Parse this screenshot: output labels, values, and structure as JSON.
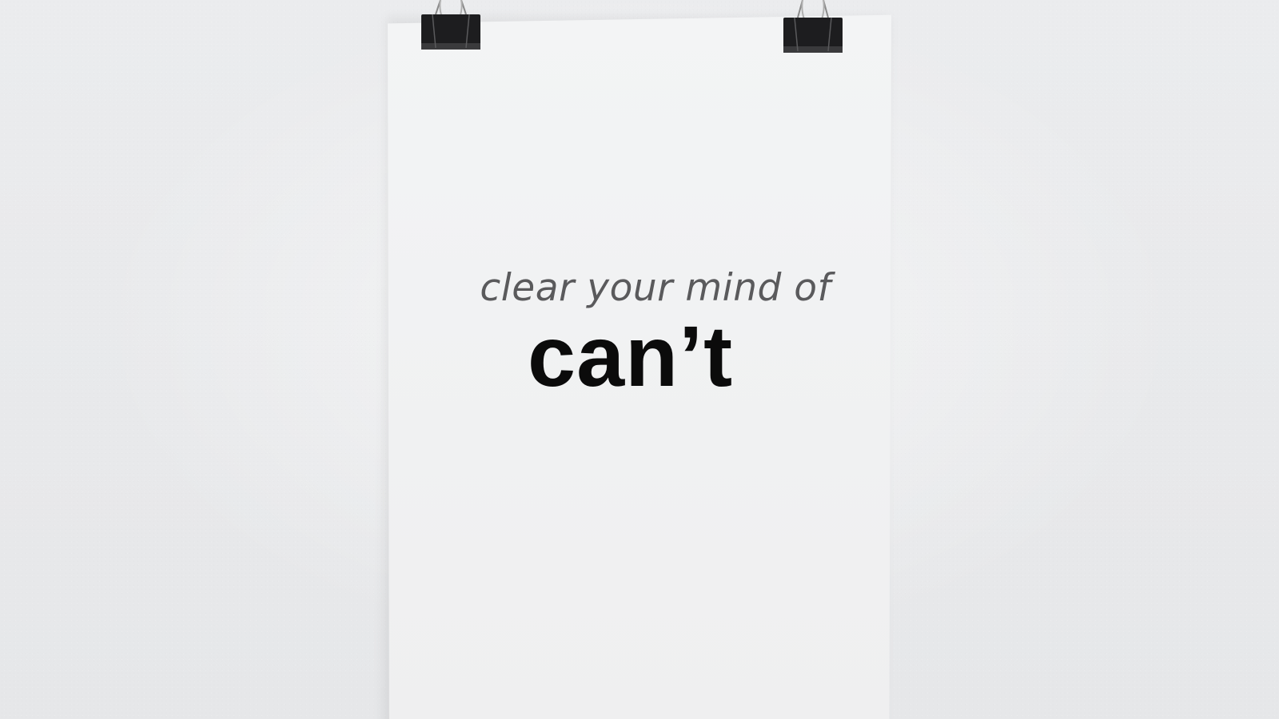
{
  "scene": {
    "background_color": "#e9eaeb",
    "poster_color": "#f2f3f4"
  },
  "poster": {
    "line_1": "clear your mind of",
    "line_2": "can’t",
    "line_1_color": "#5a5a5c",
    "line_2_color": "#0b0b0b"
  },
  "clips": [
    {
      "icon": "binder-clip-icon"
    },
    {
      "icon": "binder-clip-icon"
    }
  ]
}
